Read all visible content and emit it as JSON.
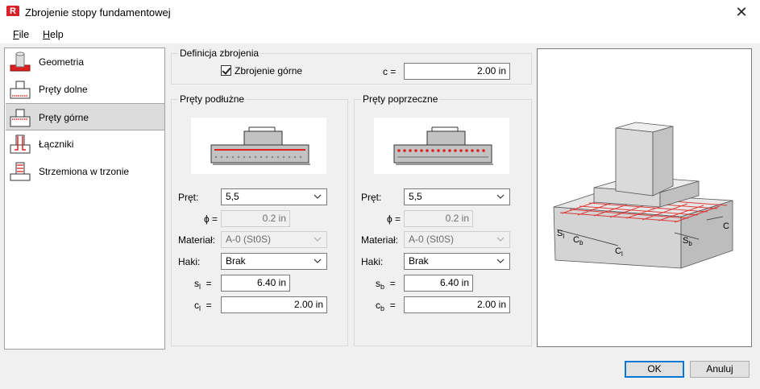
{
  "window": {
    "title": "Zbrojenie stopy fundamentowej",
    "app_icon_letter": "R",
    "close_glyph": "✕"
  },
  "menu": [
    {
      "label": "File",
      "accel": "F",
      "rest": "ile"
    },
    {
      "label": "Help",
      "accel": "H",
      "rest": "elp"
    }
  ],
  "sidebar": {
    "items": [
      {
        "label": "Geometria",
        "icon": "footing-geometry-icon",
        "selected": false
      },
      {
        "label": "Pręty dolne",
        "icon": "bottom-bars-icon",
        "selected": false
      },
      {
        "label": "Pręty górne",
        "icon": "top-bars-icon",
        "selected": true
      },
      {
        "label": "Łączniki",
        "icon": "connectors-icon",
        "selected": false
      },
      {
        "label": "Strzemiona w trzonie",
        "icon": "stirrups-icon",
        "selected": false
      }
    ]
  },
  "definition": {
    "title": "Definicja zbrojenia",
    "top_reinforcement_label": "Zbrojenie górne",
    "top_reinforcement_checked": true,
    "c_label": "c =",
    "c_value": "2.00 in"
  },
  "longitudinal": {
    "title": "Pręty podłużne",
    "bar_label": "Pręt:",
    "bar_value": "5,5",
    "phi_label": "ϕ =",
    "phi_value": "0.2 in",
    "material_label": "Materiał:",
    "material_value": "A-0 (St0S)",
    "hooks_label": "Haki:",
    "hooks_value": "Brak",
    "s_label_main": "s",
    "s_label_sub": "l",
    "s_label_eq": "=",
    "s_value": "6.40 in",
    "c_label_main": "c",
    "c_label_sub": "l",
    "c_label_eq": "=",
    "c_value": "2.00 in"
  },
  "transverse": {
    "title": "Pręty poprzeczne",
    "bar_label": "Pręt:",
    "bar_value": "5,5",
    "phi_label": "ϕ =",
    "phi_value": "0.2 in",
    "material_label": "Materiał:",
    "material_value": "A-0 (St0S)",
    "hooks_label": "Haki:",
    "hooks_value": "Brak",
    "s_label_main": "s",
    "s_label_sub": "b",
    "s_label_eq": "=",
    "s_value": "6.40 in",
    "c_label_main": "c",
    "c_label_sub": "b",
    "c_label_eq": "=",
    "c_value": "2.00 in"
  },
  "diagram": {
    "label_sl_main": "S",
    "label_sl_sub": "l",
    "label_cb_main": "C",
    "label_cb_sub": "b",
    "label_cl_main": "C",
    "label_cl_sub": "l",
    "label_sb_main": "S",
    "label_sb_sub": "b",
    "label_c": "C"
  },
  "buttons": {
    "ok": "OK",
    "cancel": "Anuluj"
  },
  "colors": {
    "accent": "#0078d7",
    "rebar": "#e02020",
    "brand": "#d6232a"
  }
}
